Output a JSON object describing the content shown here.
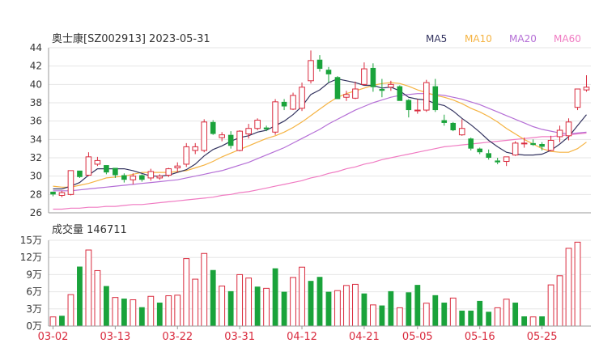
{
  "header": {
    "title": "奥士康[SZ002913] 2023-05-31"
  },
  "legend": [
    {
      "label": "MA5",
      "color": "#33335f"
    },
    {
      "label": "MA10",
      "color": "#f5b342"
    },
    {
      "label": "MA20",
      "color": "#b56fd6"
    },
    {
      "label": "MA60",
      "color": "#f07bc2"
    }
  ],
  "volume_panel": {
    "label": "成交量 146711"
  },
  "colors": {
    "up": "#d92a3d",
    "down": "#1aa33b",
    "grid": "#e6e6e6",
    "axis_text": "#333333",
    "date_text": "#d92a3d"
  },
  "chart_data": [
    {
      "type": "candlestick",
      "ylim": [
        26,
        44
      ],
      "y_ticks": [
        "26",
        "28",
        "30",
        "32",
        "34",
        "36",
        "38",
        "40",
        "42",
        "44"
      ],
      "x_ticks": [
        {
          "label": "03-02",
          "index": 0
        },
        {
          "label": "03-13",
          "index": 7
        },
        {
          "label": "03-22",
          "index": 14
        },
        {
          "label": "03-31",
          "index": 21
        },
        {
          "label": "04-12",
          "index": 28
        },
        {
          "label": "04-21",
          "index": 35
        },
        {
          "label": "05-05",
          "index": 41
        },
        {
          "label": "05-16",
          "index": 48
        },
        {
          "label": "05-25",
          "index": 55
        }
      ],
      "ohlc": [
        [
          28.3,
          28.3,
          27.8,
          28.0
        ],
        [
          27.9,
          28.4,
          27.7,
          28.2
        ],
        [
          28.0,
          30.6,
          27.9,
          30.6
        ],
        [
          30.6,
          30.6,
          29.8,
          29.9
        ],
        [
          30.1,
          32.6,
          30.0,
          32.1
        ],
        [
          31.3,
          32.1,
          31.1,
          31.7
        ],
        [
          31.2,
          31.2,
          30.2,
          30.4
        ],
        [
          30.9,
          30.9,
          29.8,
          30.1
        ],
        [
          30.1,
          30.3,
          29.3,
          29.6
        ],
        [
          29.6,
          30.3,
          29.1,
          30.0
        ],
        [
          30.1,
          30.2,
          29.4,
          29.6
        ],
        [
          29.8,
          30.8,
          29.5,
          30.5
        ],
        [
          29.8,
          30.2,
          29.6,
          30.0
        ],
        [
          30.1,
          30.9,
          29.9,
          30.8
        ],
        [
          30.9,
          31.5,
          30.4,
          31.1
        ],
        [
          31.3,
          33.6,
          31.0,
          33.2
        ],
        [
          32.8,
          33.6,
          32.4,
          33.2
        ],
        [
          32.8,
          36.2,
          32.6,
          35.9
        ],
        [
          35.9,
          36.1,
          34.5,
          34.6
        ],
        [
          34.2,
          34.8,
          33.8,
          34.5
        ],
        [
          34.5,
          34.9,
          33.0,
          33.3
        ],
        [
          32.8,
          35.0,
          32.7,
          34.9
        ],
        [
          34.6,
          35.7,
          34.1,
          35.2
        ],
        [
          35.2,
          36.3,
          35.0,
          36.1
        ],
        [
          35.3,
          35.5,
          34.9,
          35.1
        ],
        [
          34.8,
          38.4,
          34.5,
          38.1
        ],
        [
          38.1,
          38.4,
          37.2,
          37.6
        ],
        [
          37.3,
          39.1,
          37.2,
          38.8
        ],
        [
          37.4,
          40.2,
          37.1,
          39.7
        ],
        [
          40.4,
          43.7,
          40.1,
          42.6
        ],
        [
          42.7,
          43.2,
          41.4,
          41.7
        ],
        [
          41.6,
          41.9,
          40.2,
          41.1
        ],
        [
          40.8,
          40.9,
          38.4,
          38.4
        ],
        [
          38.6,
          39.3,
          38.2,
          38.9
        ],
        [
          38.5,
          40.3,
          38.4,
          39.5
        ],
        [
          40.0,
          42.4,
          39.9,
          41.7
        ],
        [
          41.8,
          42.3,
          39.2,
          39.7
        ],
        [
          39.5,
          40.6,
          38.6,
          39.3
        ],
        [
          39.7,
          40.4,
          39.3,
          40.0
        ],
        [
          39.8,
          39.9,
          38.2,
          38.2
        ],
        [
          38.3,
          38.4,
          36.4,
          37.2
        ],
        [
          37.2,
          38.4,
          36.8,
          37.2
        ],
        [
          37.2,
          40.5,
          37.0,
          40.2
        ],
        [
          39.8,
          40.6,
          37.0,
          37.2
        ],
        [
          36.1,
          36.7,
          35.5,
          35.8
        ],
        [
          35.8,
          35.9,
          34.9,
          35.0
        ],
        [
          34.5,
          36.2,
          34.4,
          35.2
        ],
        [
          34.1,
          34.2,
          32.8,
          33.0
        ],
        [
          33.0,
          33.1,
          32.4,
          32.6
        ],
        [
          32.5,
          32.9,
          31.8,
          32.0
        ],
        [
          31.7,
          32.0,
          31.3,
          31.5
        ],
        [
          31.6,
          32.1,
          31.1,
          32.1
        ],
        [
          32.3,
          33.8,
          32.2,
          33.6
        ],
        [
          33.6,
          34.2,
          33.1,
          33.6
        ],
        [
          33.6,
          34.0,
          33.3,
          33.4
        ],
        [
          33.5,
          33.7,
          32.8,
          33.2
        ],
        [
          32.8,
          34.4,
          32.7,
          33.9
        ],
        [
          34.3,
          35.5,
          33.7,
          35.0
        ],
        [
          34.4,
          36.3,
          33.9,
          35.9
        ],
        [
          37.5,
          39.5,
          37.2,
          39.5
        ],
        [
          39.4,
          41.0,
          39.2,
          39.7
        ]
      ],
      "ma5": [
        28.6,
        28.6,
        28.9,
        29.3,
        30.1,
        30.8,
        30.8,
        30.8,
        30.8,
        30.6,
        30.3,
        30.0,
        30.0,
        30.1,
        30.4,
        30.7,
        31.3,
        32.2,
        32.9,
        33.3,
        33.8,
        34.2,
        34.4,
        34.8,
        35.0,
        35.5,
        36.0,
        36.7,
        37.6,
        38.9,
        39.4,
        40.2,
        40.6,
        40.4,
        40.2,
        39.9,
        39.9,
        39.6,
        39.7,
        39.3,
        38.6,
        38.4,
        38.3,
        37.9,
        37.7,
        37.1,
        36.3,
        35.6,
        34.8,
        33.9,
        33.2,
        32.6,
        32.4,
        32.3,
        32.3,
        32.4,
        32.8,
        33.5,
        34.3,
        35.5,
        36.7
      ],
      "ma10": [
        28.9,
        28.8,
        28.8,
        29.0,
        29.2,
        29.5,
        29.8,
        29.9,
        30.0,
        30.2,
        30.4,
        30.4,
        30.4,
        30.4,
        30.5,
        30.6,
        30.9,
        31.2,
        31.6,
        32.1,
        32.5,
        32.9,
        33.3,
        33.7,
        34.1,
        34.4,
        34.8,
        35.3,
        35.9,
        36.6,
        37.3,
        38.0,
        38.6,
        39.0,
        39.3,
        39.6,
        39.9,
        40.1,
        40.2,
        40.1,
        39.8,
        39.4,
        39.1,
        38.8,
        38.6,
        38.3,
        37.9,
        37.4,
        37.0,
        36.5,
        35.9,
        35.2,
        34.6,
        34.0,
        33.5,
        33.0,
        32.7,
        32.6,
        32.6,
        33.0,
        33.7
      ],
      "ma20": [
        28.4,
        28.4,
        28.4,
        28.5,
        28.6,
        28.7,
        28.8,
        28.9,
        29.0,
        29.1,
        29.2,
        29.3,
        29.4,
        29.5,
        29.6,
        29.8,
        30.0,
        30.2,
        30.4,
        30.6,
        30.9,
        31.2,
        31.5,
        31.9,
        32.3,
        32.7,
        33.1,
        33.6,
        34.1,
        34.6,
        35.1,
        35.7,
        36.2,
        36.7,
        37.2,
        37.6,
        38.0,
        38.3,
        38.6,
        38.8,
        38.9,
        39.0,
        39.0,
        38.9,
        38.8,
        38.6,
        38.4,
        38.1,
        37.8,
        37.4,
        37.0,
        36.6,
        36.2,
        35.8,
        35.4,
        35.1,
        34.9,
        34.7,
        34.6,
        34.7,
        34.8
      ],
      "ma60": [
        26.4,
        26.4,
        26.5,
        26.5,
        26.6,
        26.6,
        26.7,
        26.7,
        26.8,
        26.9,
        26.9,
        27.0,
        27.1,
        27.2,
        27.3,
        27.4,
        27.5,
        27.6,
        27.7,
        27.9,
        28.0,
        28.2,
        28.3,
        28.5,
        28.7,
        28.9,
        29.1,
        29.3,
        29.5,
        29.8,
        30.0,
        30.3,
        30.5,
        30.8,
        31.0,
        31.3,
        31.5,
        31.8,
        32.0,
        32.2,
        32.4,
        32.6,
        32.8,
        33.0,
        33.2,
        33.3,
        33.4,
        33.5,
        33.6,
        33.7,
        33.8,
        33.9,
        34.0,
        34.1,
        34.2,
        34.3,
        34.3,
        34.4,
        34.5,
        34.6,
        34.7
      ]
    },
    {
      "type": "bar",
      "ylim": [
        0,
        150000
      ],
      "y_ticks": [
        "0万",
        "3万",
        "6万",
        "9万",
        "12万",
        "15万"
      ],
      "values": [
        16000,
        18000,
        55000,
        104000,
        133000,
        97000,
        70000,
        50000,
        48000,
        46000,
        33000,
        52000,
        41000,
        53000,
        54000,
        118000,
        82000,
        127000,
        98000,
        70000,
        61000,
        90000,
        84000,
        69000,
        66000,
        101000,
        60000,
        85000,
        103000,
        79000,
        86000,
        60000,
        62000,
        71000,
        73000,
        57000,
        37000,
        36000,
        61000,
        32000,
        59000,
        72000,
        40000,
        54000,
        41000,
        49000,
        27000,
        27000,
        44000,
        25000,
        32000,
        47000,
        41000,
        17000,
        16000,
        17000,
        72000,
        88000,
        136000,
        146711
      ],
      "direction": [
        "up",
        "down",
        "up",
        "down",
        "up",
        "up",
        "down",
        "up",
        "down",
        "up",
        "down",
        "up",
        "down",
        "up",
        "up",
        "up",
        "up",
        "up",
        "down",
        "up",
        "down",
        "up",
        "up",
        "down",
        "up",
        "down",
        "down",
        "up",
        "up",
        "down",
        "down",
        "down",
        "up",
        "up",
        "up",
        "down",
        "up",
        "down",
        "down",
        "up",
        "down",
        "down",
        "up",
        "down",
        "down",
        "up",
        "down",
        "down",
        "down",
        "down",
        "up",
        "up",
        "down",
        "down",
        "up",
        "down",
        "up",
        "up",
        "up",
        "up"
      ]
    }
  ]
}
